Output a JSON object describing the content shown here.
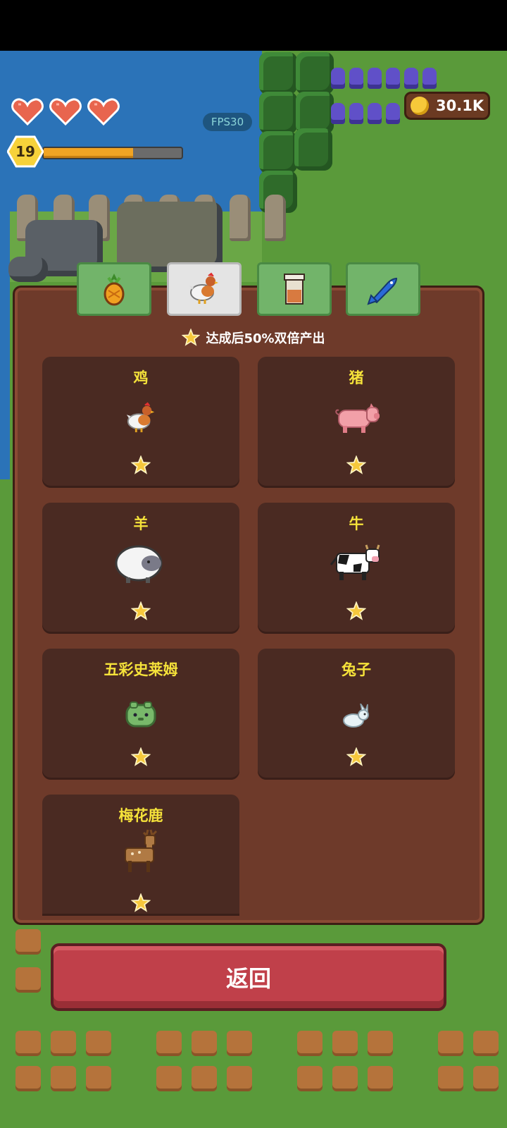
{
  "hud": {
    "hearts": 3,
    "level": "19",
    "xp_fraction": 0.65,
    "fps": "FPS30",
    "coins": "30.1K"
  },
  "tabs": [
    {
      "id": "crops",
      "icon": "pineapple-icon",
      "active": false
    },
    {
      "id": "animals",
      "icon": "chicken-icon",
      "active": true
    },
    {
      "id": "products",
      "icon": "jar-icon",
      "active": false
    },
    {
      "id": "fish",
      "icon": "fish-icon",
      "active": false
    }
  ],
  "panel": {
    "bonus_text": "达成后50%双倍产出",
    "cards": [
      {
        "name": "鸡",
        "icon": "chicken-icon",
        "stars": 1
      },
      {
        "name": "猪",
        "icon": "pig-icon",
        "stars": 1
      },
      {
        "name": "羊",
        "icon": "sheep-icon",
        "stars": 1
      },
      {
        "name": "牛",
        "icon": "cow-icon",
        "stars": 1
      },
      {
        "name": "五彩史莱姆",
        "icon": "slime-icon",
        "stars": 1
      },
      {
        "name": "兔子",
        "icon": "rabbit-icon",
        "stars": 1
      },
      {
        "name": "梅花鹿",
        "icon": "deer-icon",
        "stars": 1
      }
    ]
  },
  "back_button": {
    "label": "返回"
  },
  "colors": {
    "panel_bg": "#6e3a2a",
    "card_bg": "#4a2a22",
    "card_title": "#f5e23a",
    "tab_green": "#72b46a",
    "tab_active": "#e4e4e4",
    "back_button": "#c0404a",
    "xp_fill": "#f0a424"
  }
}
